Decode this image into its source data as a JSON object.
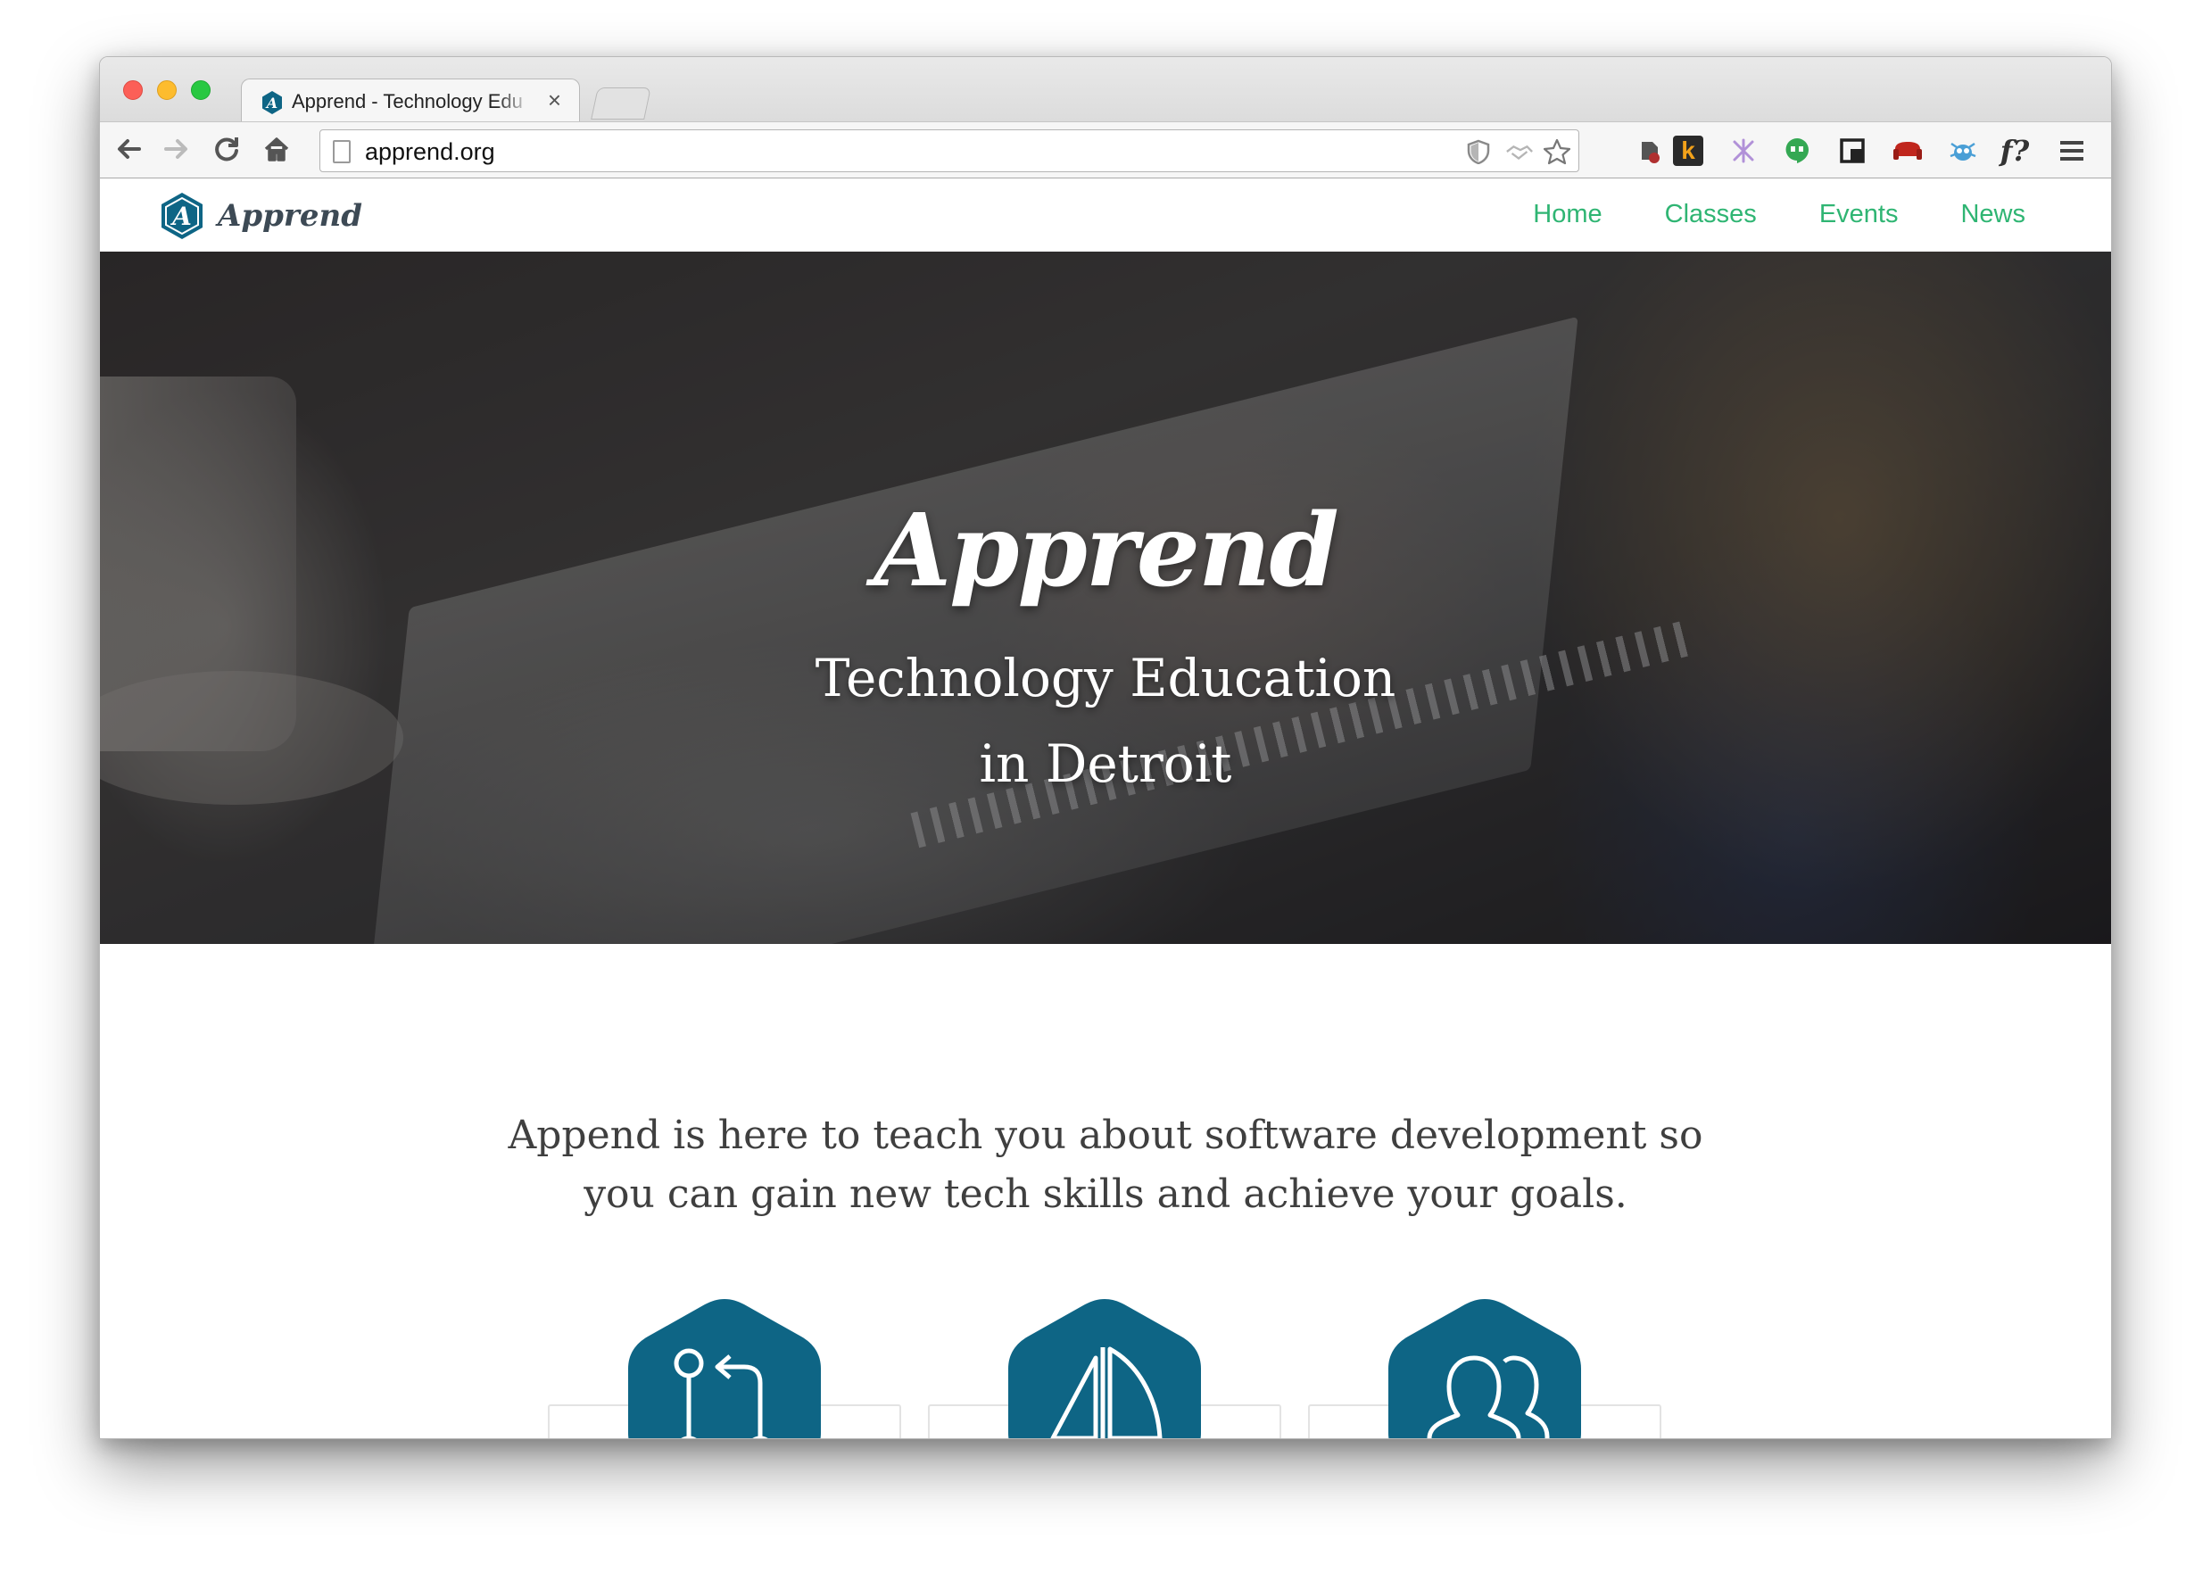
{
  "browser": {
    "tab": {
      "title": "Apprend - Technology Edu",
      "close_glyph": "×"
    },
    "toolbar": {
      "url": "apprend.org"
    },
    "extensions": [
      "evernote-icon",
      "k-icon",
      "puzzle-icon",
      "hangouts-icon",
      "pocket-icon",
      "couch-icon",
      "bug-icon",
      "whatfont-icon",
      "menu-icon"
    ],
    "ext_labels": {
      "k": "k",
      "whatfont": "f?"
    }
  },
  "site": {
    "brand": "Apprend",
    "nav": [
      "Home",
      "Classes",
      "Events",
      "News"
    ],
    "hero": {
      "title": "Apprend",
      "subtitle_line1": "Technology Education",
      "subtitle_line2": "in Detroit"
    },
    "intro": {
      "line1": "Append is here to teach you about software development so",
      "line2": "you can gain new tech skills and achieve your goals."
    },
    "features": [
      {
        "icon": "git-pull-request-icon"
      },
      {
        "icon": "sailboat-icon"
      },
      {
        "icon": "users-icon"
      }
    ]
  },
  "colors": {
    "accent_green": "#2fb573",
    "badge_blue": "#0e6585",
    "brand_text": "#3d4a55"
  }
}
